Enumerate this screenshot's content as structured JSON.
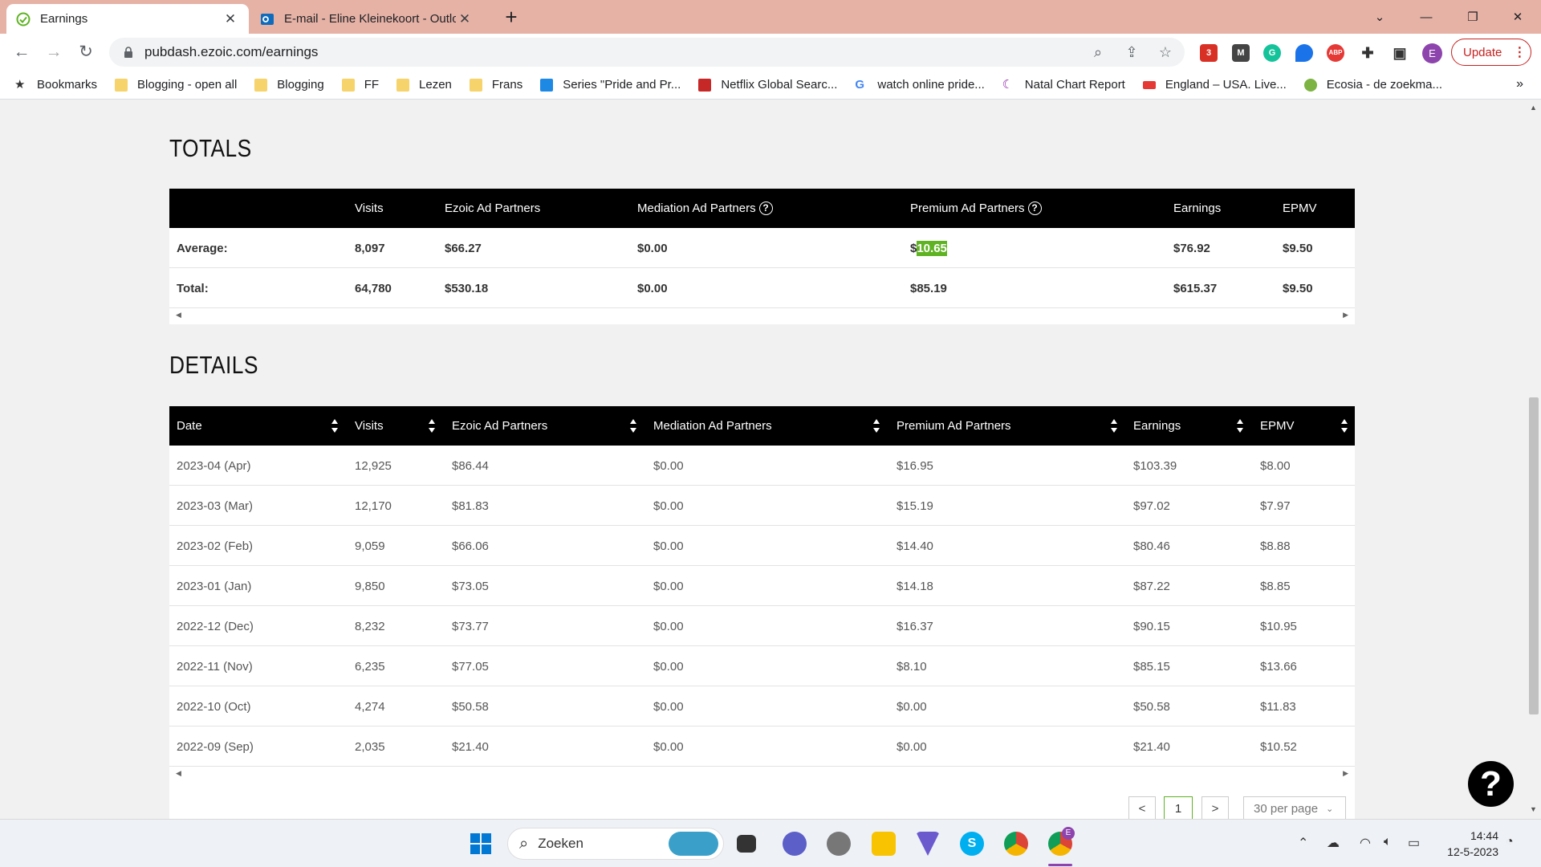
{
  "browser": {
    "tabs": [
      {
        "label": "Earnings",
        "close": "✕"
      },
      {
        "label": "E-mail - Eline Kleinekoort - Outlo",
        "close": "✕"
      }
    ],
    "new_tab": "+",
    "url": "pubdash.ezoic.com/earnings",
    "update_label": "Update",
    "update_menu": "⋮",
    "profile_initial": "E",
    "ext_badge": "3",
    "ext_abp": "ABP"
  },
  "bookmarks": [
    {
      "label": "Bookmarks",
      "icon": "star-icon"
    },
    {
      "label": "Blogging - open all",
      "icon": "folder-icon"
    },
    {
      "label": "Blogging",
      "icon": "folder-icon"
    },
    {
      "label": "FF",
      "icon": "folder-icon"
    },
    {
      "label": "Lezen",
      "icon": "folder-icon"
    },
    {
      "label": "Frans",
      "icon": "folder-icon"
    },
    {
      "label": "Series \"Pride and Pr...",
      "icon": "series-icon"
    },
    {
      "label": "Netflix Global Searc...",
      "icon": "netflix-icon"
    },
    {
      "label": "watch online pride...",
      "icon": "google-icon"
    },
    {
      "label": "Natal Chart Report",
      "icon": "moon-icon"
    },
    {
      "label": "England – USA. Live...",
      "icon": "live-icon"
    },
    {
      "label": "Ecosia - de zoekma...",
      "icon": "ecosia-icon"
    }
  ],
  "bookmarks_more": "»",
  "totals": {
    "title": "TOTALS",
    "headers": [
      "Visits",
      "Ezoic Ad Partners",
      "Mediation Ad Partners",
      "Premium Ad Partners",
      "Earnings",
      "EPMV"
    ],
    "help_glyph": "?",
    "rows": [
      {
        "label": "Average:",
        "visits": "8,097",
        "ezoic": "$66.27",
        "mediation": "$0.00",
        "premium_prefix": "$",
        "premium_highlight": "10.65",
        "earnings": "$76.92",
        "epmv": "$9.50"
      },
      {
        "label": "Total:",
        "visits": "64,780",
        "ezoic": "$530.18",
        "mediation": "$0.00",
        "premium": "$85.19",
        "earnings": "$615.37",
        "epmv": "$9.50"
      }
    ]
  },
  "details": {
    "title": "DETAILS",
    "headers": [
      "Date",
      "Visits",
      "Ezoic Ad Partners",
      "Mediation Ad Partners",
      "Premium Ad Partners",
      "Earnings",
      "EPMV"
    ],
    "rows": [
      [
        "2023-04 (Apr)",
        "12,925",
        "$86.44",
        "$0.00",
        "$16.95",
        "$103.39",
        "$8.00"
      ],
      [
        "2023-03 (Mar)",
        "12,170",
        "$81.83",
        "$0.00",
        "$15.19",
        "$97.02",
        "$7.97"
      ],
      [
        "2023-02 (Feb)",
        "9,059",
        "$66.06",
        "$0.00",
        "$14.40",
        "$80.46",
        "$8.88"
      ],
      [
        "2023-01 (Jan)",
        "9,850",
        "$73.05",
        "$0.00",
        "$14.18",
        "$87.22",
        "$8.85"
      ],
      [
        "2022-12 (Dec)",
        "8,232",
        "$73.77",
        "$0.00",
        "$16.37",
        "$90.15",
        "$10.95"
      ],
      [
        "2022-11 (Nov)",
        "6,235",
        "$77.05",
        "$0.00",
        "$8.10",
        "$85.15",
        "$13.66"
      ],
      [
        "2022-10 (Oct)",
        "4,274",
        "$50.58",
        "$0.00",
        "$0.00",
        "$50.58",
        "$11.83"
      ],
      [
        "2022-09 (Sep)",
        "2,035",
        "$21.40",
        "$0.00",
        "$0.00",
        "$21.40",
        "$10.52"
      ]
    ]
  },
  "pagination": {
    "prev": "<",
    "current": "1",
    "next": ">",
    "per_page": "30 per page"
  },
  "help_button": "?",
  "taskbar": {
    "search_label": "Zoeken",
    "time": "14:44",
    "date": "12-5-2023",
    "profile_badge": "E"
  }
}
